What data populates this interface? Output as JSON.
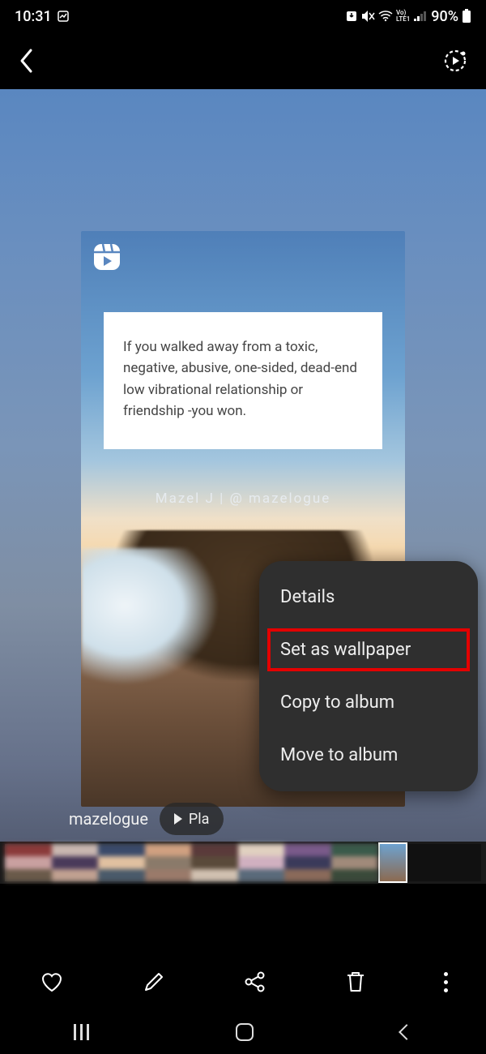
{
  "status": {
    "time": "10:31",
    "battery_pct": "90%",
    "network_label": "LTE1",
    "volte_label": "Vo)"
  },
  "image": {
    "quote": "If you walked away from a toxic, negative, abusive, one-sided, dead-end low vibrational relationship or friendship -you won.",
    "credit": "Mazel J | @ mazelogue"
  },
  "caption": {
    "username": "mazelogue",
    "play_label": "Pla"
  },
  "menu": {
    "items": [
      "Details",
      "Set as wallpaper",
      "Copy to album",
      "Move to album"
    ],
    "highlighted_index": 1
  }
}
